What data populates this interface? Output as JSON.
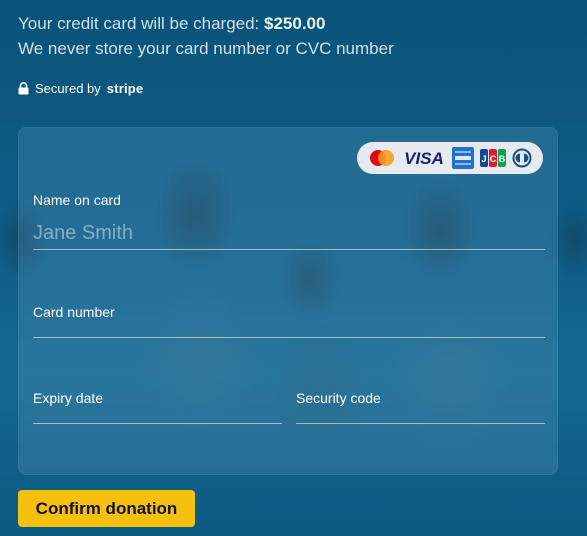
{
  "header": {
    "charge_prefix": "Your credit card will be charged: ",
    "charge_amount": "$250.00",
    "store_notice": "We never store your card number or CVC number"
  },
  "secured": {
    "icon": "lock-icon",
    "label": "Secured by",
    "brand": "stripe"
  },
  "card_brands": [
    {
      "name": "mastercard",
      "colors": [
        "#eb001b",
        "#f79e1b"
      ]
    },
    {
      "name": "visa",
      "text": "VISA",
      "color": "#1a1f71"
    },
    {
      "name": "amex",
      "color": "#1f72cd"
    },
    {
      "name": "jcb",
      "text": "JCB"
    },
    {
      "name": "diners"
    }
  ],
  "form": {
    "name_label": "Name on card",
    "name_placeholder": "Jane Smith",
    "card_number_label": "Card number",
    "expiry_label": "Expiry date",
    "security_label": "Security code"
  },
  "actions": {
    "confirm_label": "Confirm donation",
    "confirm_color": "#f6c10e"
  },
  "colors": {
    "background": "#0d5a82",
    "panel": "rgba(120,170,200,0.22)"
  }
}
